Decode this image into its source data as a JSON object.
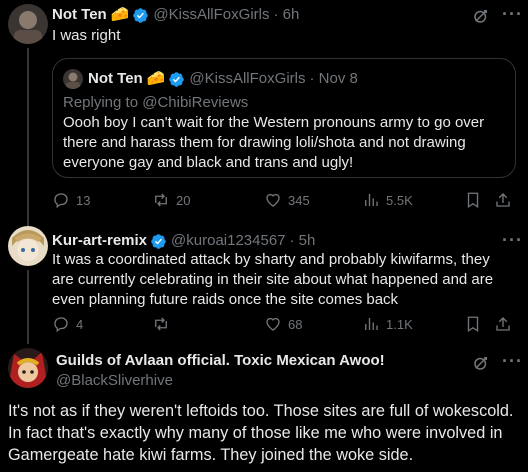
{
  "tweet1": {
    "name": "Not Ten",
    "name_emoji": "🧀",
    "handle": "@KissAllFoxGirls",
    "time": "· 6h",
    "text": "I was right",
    "quote": {
      "name": "Not Ten",
      "name_emoji": "🧀",
      "handle": "@KissAllFoxGirls",
      "time": "· Nov 8",
      "replying": "Replying to @ChibiReviews",
      "text": "Oooh boy I can't wait for the Western pronouns army to go over there and harass them for drawing loli/shota and not drawing everyone gay and black and trans and ugly!"
    },
    "stats": {
      "replies": "13",
      "reposts": "20",
      "likes": "345",
      "views": "5.5K"
    }
  },
  "tweet2": {
    "name": "Kur-art-remix",
    "handle": "@kuroai1234567",
    "time": "· 5h",
    "text": "It was a coordinated attack by sharty and probably kiwifarms, they are currently celebrating in their site about what happened and are even planning future raids once the site comes back",
    "stats": {
      "replies": "4",
      "reposts": "",
      "likes": "68",
      "views": "1.1K"
    }
  },
  "tweet3": {
    "name": "Guilds of Avlaan official. Toxic Mexican Awoo!",
    "handle": "@BlackSliverhive",
    "text": "It's not as if they weren't leftoids too. Those sites are full of wokescold. In fact that's exactly why many of those like me who were involved in Gamergeate hate kiwi farms. They joined the woke side."
  },
  "colors": {
    "accent": "#1d9bf0",
    "muted": "#71767b",
    "background": "#000000"
  }
}
